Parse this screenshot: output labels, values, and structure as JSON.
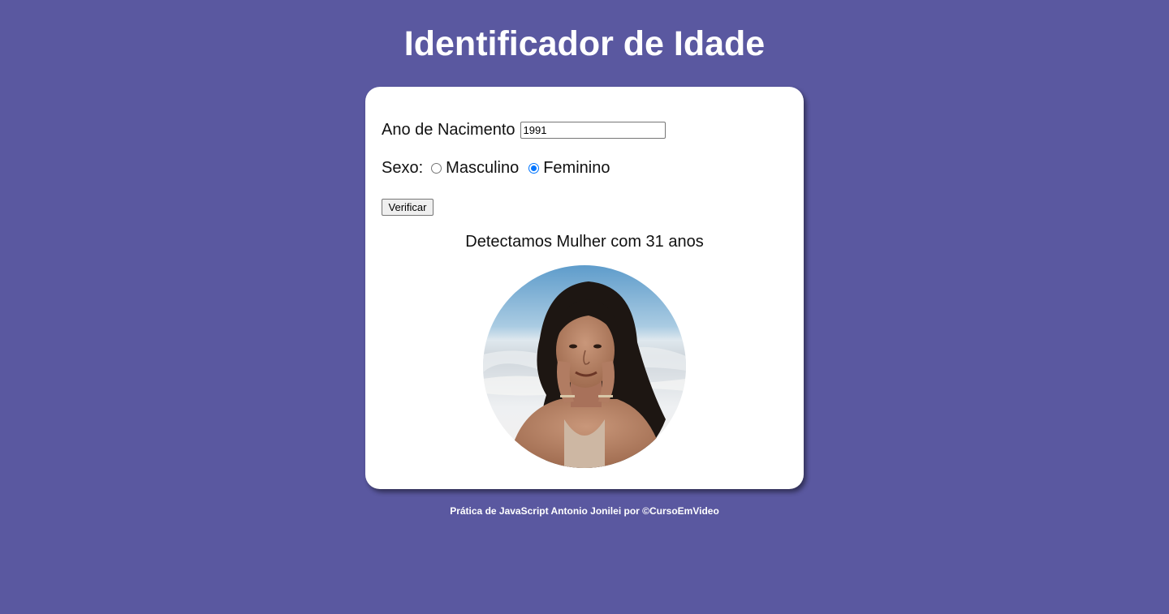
{
  "header": {
    "title": "Identificador de Idade"
  },
  "form": {
    "year_label": "Ano de Nacimento",
    "year_value": "1991",
    "sex_label": "Sexo:",
    "sex_options": [
      {
        "label": "Masculino",
        "checked": false
      },
      {
        "label": "Feminino",
        "checked": true
      }
    ],
    "verify_label": "Verificar"
  },
  "result": {
    "text": "Detectamos Mulher com 31 anos",
    "image_icon": "woman-photo"
  },
  "footer": {
    "text": "Prática de JavaScript Antonio Jonilei por ©CursoEmVideo"
  },
  "colors": {
    "background": "#5a58a0",
    "card": "#ffffff",
    "radio_accent": "#0075ff"
  }
}
